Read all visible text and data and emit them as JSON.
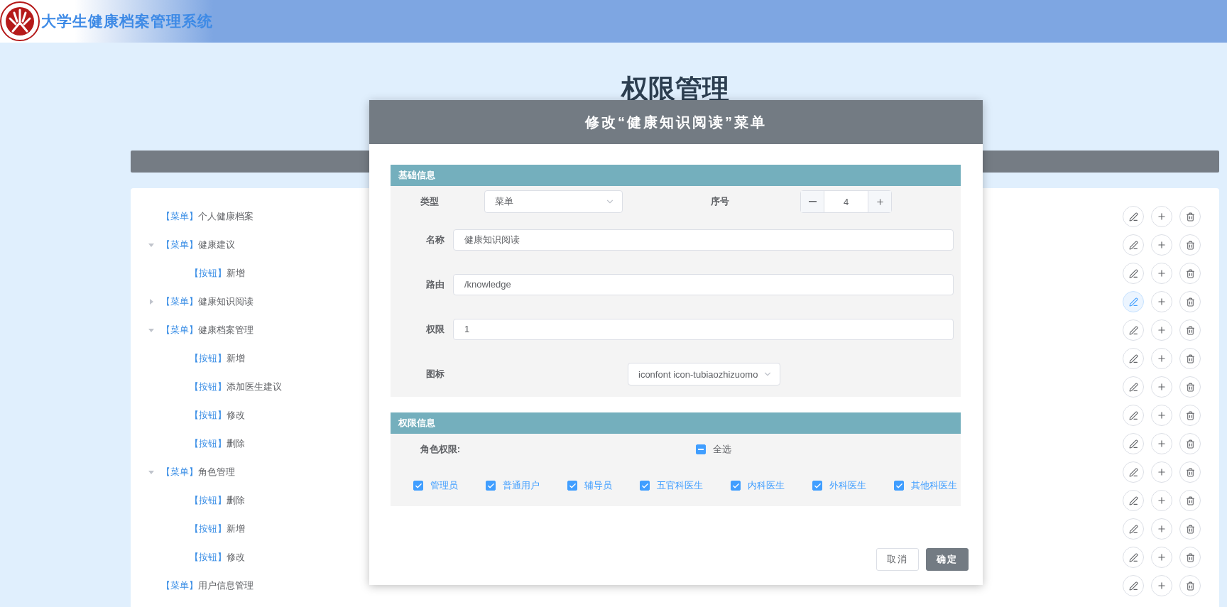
{
  "header": {
    "system_name": "大学生健康档案管理系统"
  },
  "page_title": "权限管理",
  "tree": [
    {
      "type_tag": "【菜单】",
      "name": "个人健康档案",
      "edit_hovered": false
    },
    {
      "type_tag": "【菜单】",
      "name": "健康建议",
      "expanded": true,
      "edit_hovered": false,
      "children": [
        {
          "type_tag": "【按钮】",
          "name": "新增",
          "edit_hovered": false
        }
      ]
    },
    {
      "type_tag": "【菜单】",
      "name": "健康知识阅读",
      "expanded": false,
      "edit_hovered": true
    },
    {
      "type_tag": "【菜单】",
      "name": "健康档案管理",
      "expanded": true,
      "edit_hovered": false,
      "children": [
        {
          "type_tag": "【按钮】",
          "name": "新增",
          "edit_hovered": false
        },
        {
          "type_tag": "【按钮】",
          "name": "添加医生建议",
          "edit_hovered": false
        },
        {
          "type_tag": "【按钮】",
          "name": "修改",
          "edit_hovered": false
        },
        {
          "type_tag": "【按钮】",
          "name": "删除",
          "edit_hovered": false
        }
      ]
    },
    {
      "type_tag": "【菜单】",
      "name": "角色管理",
      "expanded": true,
      "edit_hovered": false,
      "children": [
        {
          "type_tag": "【按钮】",
          "name": "删除",
          "edit_hovered": false
        },
        {
          "type_tag": "【按钮】",
          "name": "新增",
          "edit_hovered": false
        },
        {
          "type_tag": "【按钮】",
          "name": "修改",
          "edit_hovered": false
        }
      ]
    },
    {
      "type_tag": "【菜单】",
      "name": "用户信息管理",
      "edit_hovered": false
    }
  ],
  "dialog": {
    "title": "修改“健康知识阅读”菜单",
    "basic_info": {
      "heading": "基础信息",
      "type": {
        "label": "类型",
        "value": "菜单"
      },
      "order": {
        "label": "序号",
        "value": "4"
      },
      "name": {
        "label": "名称",
        "value": "健康知识阅读"
      },
      "route": {
        "label": "路由",
        "value": "/knowledge"
      },
      "permission": {
        "label": "权限",
        "value": "1"
      },
      "icon": {
        "label": "图标",
        "value": "iconfont icon-tubiaozhizuomo"
      }
    },
    "permission_info": {
      "heading": "权限信息",
      "roles_label": "角色权限:",
      "select_all": {
        "label": "全选",
        "indeterminate": true
      },
      "roles": [
        {
          "label": "管理员",
          "checked": true
        },
        {
          "label": "普通用户",
          "checked": true
        },
        {
          "label": "辅导员",
          "checked": true
        },
        {
          "label": "五官科医生",
          "checked": true
        },
        {
          "label": "内科医生",
          "checked": true
        },
        {
          "label": "外科医生",
          "checked": true
        },
        {
          "label": "其他科医生",
          "checked": true
        }
      ]
    },
    "buttons": [
      {
        "label": "取消",
        "kind": "secondary"
      },
      {
        "label": "确定",
        "kind": "primary"
      }
    ]
  }
}
